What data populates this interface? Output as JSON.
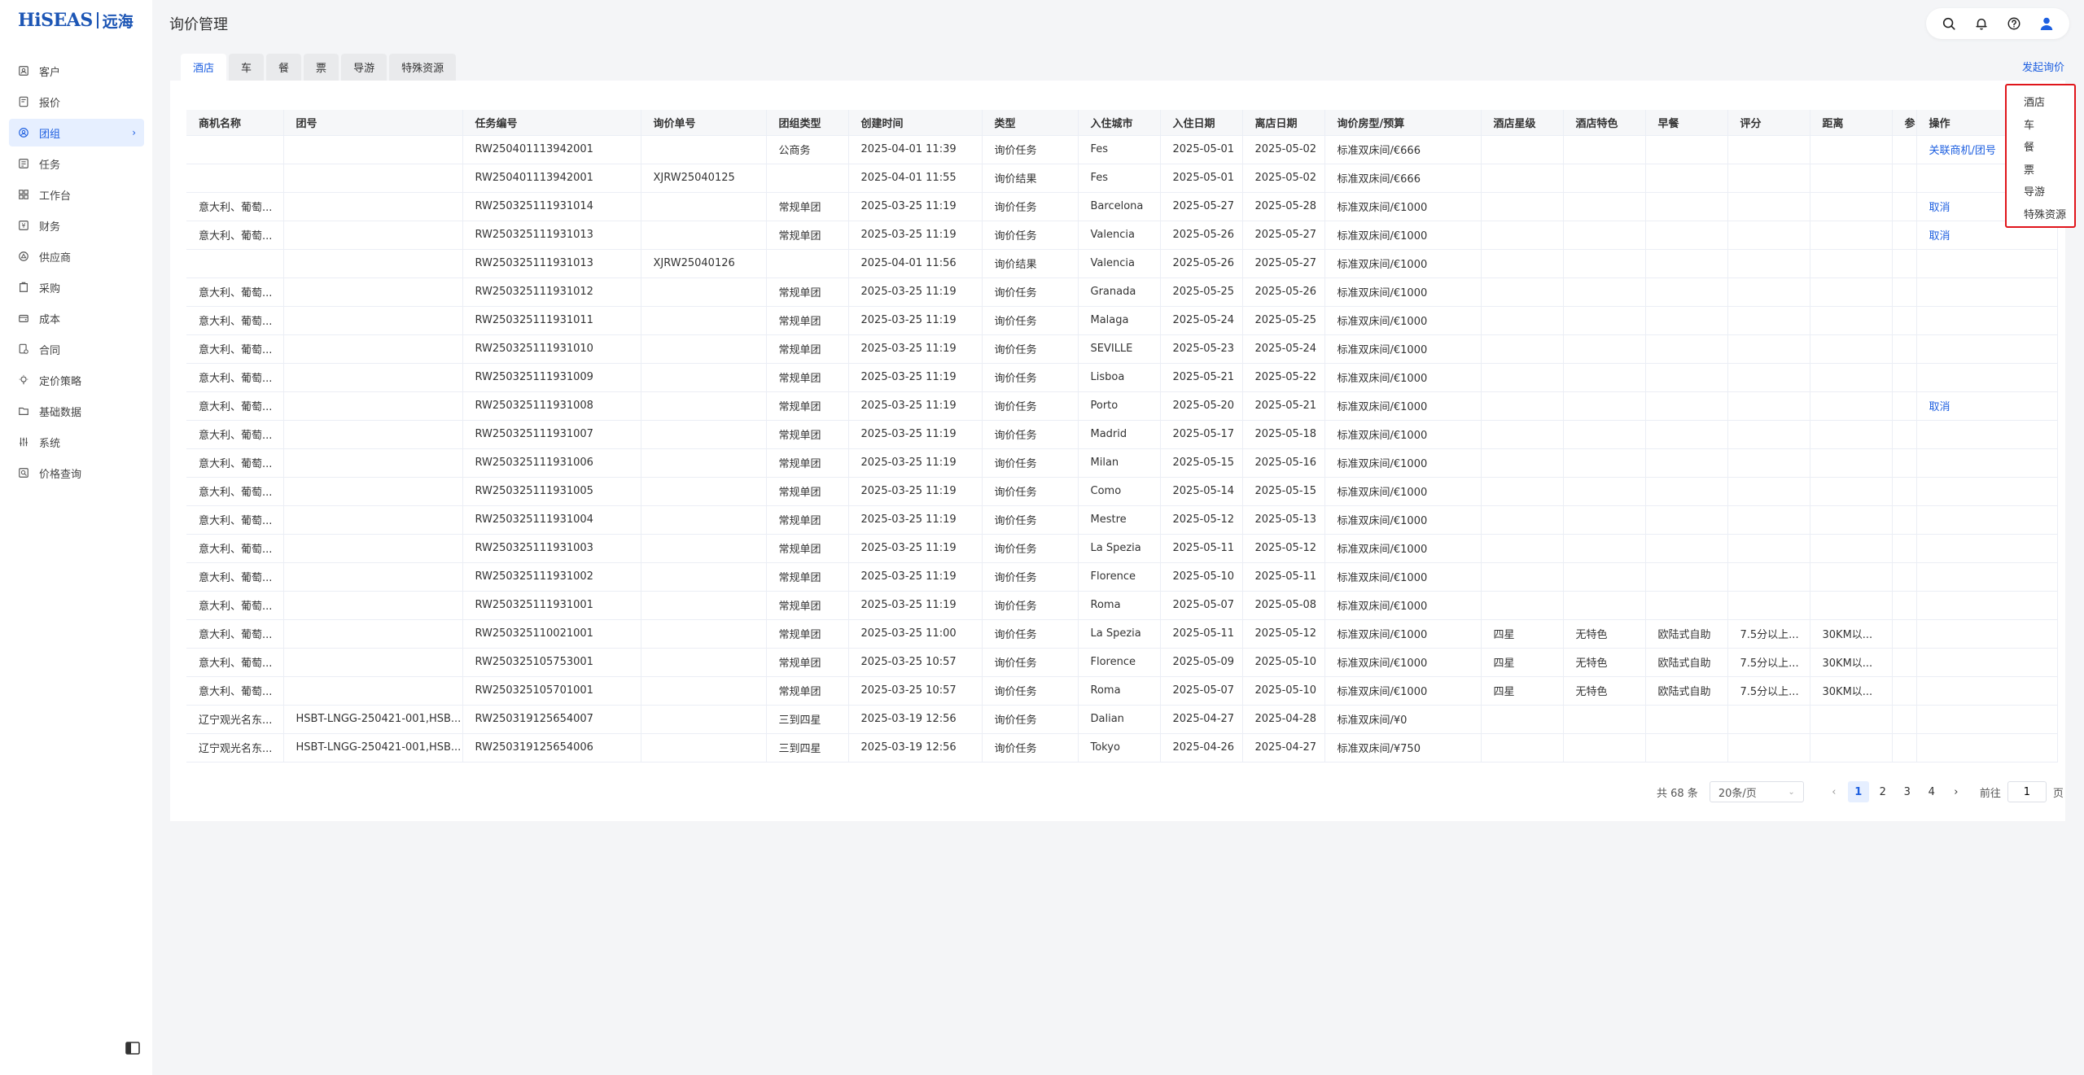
{
  "logo": {
    "main": "HiSEAS",
    "cn": "远海"
  },
  "sidebar": {
    "items": [
      {
        "label": "客户",
        "icon": "customer-icon"
      },
      {
        "label": "报价",
        "icon": "quote-icon"
      },
      {
        "label": "团组",
        "icon": "group-icon",
        "active": true
      },
      {
        "label": "任务",
        "icon": "task-icon"
      },
      {
        "label": "工作台",
        "icon": "workbench-icon"
      },
      {
        "label": "财务",
        "icon": "finance-icon"
      },
      {
        "label": "供应商",
        "icon": "supplier-icon"
      },
      {
        "label": "采购",
        "icon": "purchase-icon"
      },
      {
        "label": "成本",
        "icon": "cost-icon"
      },
      {
        "label": "合同",
        "icon": "contract-icon"
      },
      {
        "label": "定价策略",
        "icon": "pricing-strategy-icon"
      },
      {
        "label": "基础数据",
        "icon": "base-data-icon"
      },
      {
        "label": "系统",
        "icon": "system-icon"
      },
      {
        "label": "价格查询",
        "icon": "price-query-icon"
      }
    ]
  },
  "header": {
    "title": "询价管理"
  },
  "tabs": [
    "酒店",
    "车",
    "餐",
    "票",
    "导游",
    "特殊资源"
  ],
  "launch_label": "发起询价",
  "dropdown": [
    "酒店",
    "车",
    "餐",
    "票",
    "导游",
    "特殊资源"
  ],
  "table": {
    "columns": [
      "商机名称",
      "团号",
      "任务编号",
      "询价单号",
      "团组类型",
      "创建时间",
      "类型",
      "入住城市",
      "入住日期",
      "离店日期",
      "询价房型/预算",
      "酒店星级",
      "酒店特色",
      "早餐",
      "评分",
      "距离",
      "参",
      "操作"
    ],
    "rows": [
      [
        "",
        "",
        "RW250401113942001",
        "",
        "公商务",
        "2025-04-01 11:39",
        "询价任务",
        "Fes",
        "2025-05-01",
        "2025-05-02",
        "标准双床间/€666",
        "",
        "",
        "",
        "",
        "",
        "",
        "关联商机/团号"
      ],
      [
        "",
        "",
        "RW250401113942001",
        "XJRW25040125",
        "",
        "2025-04-01 11:55",
        "询价结果",
        "Fes",
        "2025-05-01",
        "2025-05-02",
        "标准双床间/€666",
        "",
        "",
        "",
        "",
        "",
        "",
        ""
      ],
      [
        "意大利、葡萄...",
        "",
        "RW250325111931014",
        "",
        "常规单团",
        "2025-03-25 11:19",
        "询价任务",
        "Barcelona",
        "2025-05-27",
        "2025-05-28",
        "标准双床间/€1000",
        "",
        "",
        "",
        "",
        "",
        "",
        "取消"
      ],
      [
        "意大利、葡萄...",
        "",
        "RW250325111931013",
        "",
        "常规单团",
        "2025-03-25 11:19",
        "询价任务",
        "Valencia",
        "2025-05-26",
        "2025-05-27",
        "标准双床间/€1000",
        "",
        "",
        "",
        "",
        "",
        "",
        "取消"
      ],
      [
        "",
        "",
        "RW250325111931013",
        "XJRW25040126",
        "",
        "2025-04-01 11:56",
        "询价结果",
        "Valencia",
        "2025-05-26",
        "2025-05-27",
        "标准双床间/€1000",
        "",
        "",
        "",
        "",
        "",
        "",
        ""
      ],
      [
        "意大利、葡萄...",
        "",
        "RW250325111931012",
        "",
        "常规单团",
        "2025-03-25 11:19",
        "询价任务",
        "Granada",
        "2025-05-25",
        "2025-05-26",
        "标准双床间/€1000",
        "",
        "",
        "",
        "",
        "",
        "",
        ""
      ],
      [
        "意大利、葡萄...",
        "",
        "RW250325111931011",
        "",
        "常规单团",
        "2025-03-25 11:19",
        "询价任务",
        "Malaga",
        "2025-05-24",
        "2025-05-25",
        "标准双床间/€1000",
        "",
        "",
        "",
        "",
        "",
        "",
        ""
      ],
      [
        "意大利、葡萄...",
        "",
        "RW250325111931010",
        "",
        "常规单团",
        "2025-03-25 11:19",
        "询价任务",
        "SEVILLE",
        "2025-05-23",
        "2025-05-24",
        "标准双床间/€1000",
        "",
        "",
        "",
        "",
        "",
        "",
        ""
      ],
      [
        "意大利、葡萄...",
        "",
        "RW250325111931009",
        "",
        "常规单团",
        "2025-03-25 11:19",
        "询价任务",
        "Lisboa",
        "2025-05-21",
        "2025-05-22",
        "标准双床间/€1000",
        "",
        "",
        "",
        "",
        "",
        "",
        ""
      ],
      [
        "意大利、葡萄...",
        "",
        "RW250325111931008",
        "",
        "常规单团",
        "2025-03-25 11:19",
        "询价任务",
        "Porto",
        "2025-05-20",
        "2025-05-21",
        "标准双床间/€1000",
        "",
        "",
        "",
        "",
        "",
        "",
        "取消"
      ],
      [
        "意大利、葡萄...",
        "",
        "RW250325111931007",
        "",
        "常规单团",
        "2025-03-25 11:19",
        "询价任务",
        "Madrid",
        "2025-05-17",
        "2025-05-18",
        "标准双床间/€1000",
        "",
        "",
        "",
        "",
        "",
        "",
        ""
      ],
      [
        "意大利、葡萄...",
        "",
        "RW250325111931006",
        "",
        "常规单团",
        "2025-03-25 11:19",
        "询价任务",
        "Milan",
        "2025-05-15",
        "2025-05-16",
        "标准双床间/€1000",
        "",
        "",
        "",
        "",
        "",
        "",
        ""
      ],
      [
        "意大利、葡萄...",
        "",
        "RW250325111931005",
        "",
        "常规单团",
        "2025-03-25 11:19",
        "询价任务",
        "Como",
        "2025-05-14",
        "2025-05-15",
        "标准双床间/€1000",
        "",
        "",
        "",
        "",
        "",
        "",
        ""
      ],
      [
        "意大利、葡萄...",
        "",
        "RW250325111931004",
        "",
        "常规单团",
        "2025-03-25 11:19",
        "询价任务",
        "Mestre",
        "2025-05-12",
        "2025-05-13",
        "标准双床间/€1000",
        "",
        "",
        "",
        "",
        "",
        "",
        ""
      ],
      [
        "意大利、葡萄...",
        "",
        "RW250325111931003",
        "",
        "常规单团",
        "2025-03-25 11:19",
        "询价任务",
        "La Spezia",
        "2025-05-11",
        "2025-05-12",
        "标准双床间/€1000",
        "",
        "",
        "",
        "",
        "",
        "",
        ""
      ],
      [
        "意大利、葡萄...",
        "",
        "RW250325111931002",
        "",
        "常规单团",
        "2025-03-25 11:19",
        "询价任务",
        "Florence",
        "2025-05-10",
        "2025-05-11",
        "标准双床间/€1000",
        "",
        "",
        "",
        "",
        "",
        "",
        ""
      ],
      [
        "意大利、葡萄...",
        "",
        "RW250325111931001",
        "",
        "常规单团",
        "2025-03-25 11:19",
        "询价任务",
        "Roma",
        "2025-05-07",
        "2025-05-08",
        "标准双床间/€1000",
        "",
        "",
        "",
        "",
        "",
        "",
        ""
      ],
      [
        "意大利、葡萄...",
        "",
        "RW250325110021001",
        "",
        "常规单团",
        "2025-03-25 11:00",
        "询价任务",
        "La Spezia",
        "2025-05-11",
        "2025-05-12",
        "标准双床间/€1000",
        "四星",
        "无特色",
        "欧陆式自助",
        "7.5分以上...",
        "30KM以...",
        "",
        ""
      ],
      [
        "意大利、葡萄...",
        "",
        "RW250325105753001",
        "",
        "常规单团",
        "2025-03-25 10:57",
        "询价任务",
        "Florence",
        "2025-05-09",
        "2025-05-10",
        "标准双床间/€1000",
        "四星",
        "无特色",
        "欧陆式自助",
        "7.5分以上...",
        "30KM以...",
        "",
        ""
      ],
      [
        "意大利、葡萄...",
        "",
        "RW250325105701001",
        "",
        "常规单团",
        "2025-03-25 10:57",
        "询价任务",
        "Roma",
        "2025-05-07",
        "2025-05-10",
        "标准双床间/€1000",
        "四星",
        "无特色",
        "欧陆式自助",
        "7.5分以上...",
        "30KM以...",
        "",
        ""
      ],
      [
        "辽宁观光名东...",
        "HSBT-LNGG-250421-001,HSB...",
        "RW250319125654007",
        "",
        "三到四星",
        "2025-03-19 12:56",
        "询价任务",
        "Dalian",
        "2025-04-27",
        "2025-04-28",
        "标准双床间/¥0",
        "",
        "",
        "",
        "",
        "",
        "",
        ""
      ],
      [
        "辽宁观光名东...",
        "HSBT-LNGG-250421-001,HSB...",
        "RW250319125654006",
        "",
        "三到四星",
        "2025-03-19 12:56",
        "询价任务",
        "Tokyo",
        "2025-04-26",
        "2025-04-27",
        "标准双床间/¥750",
        "",
        "",
        "",
        "",
        "",
        "",
        ""
      ]
    ]
  },
  "pagination": {
    "total": "共 68 条",
    "page_size": "20条/页",
    "pages": [
      "1",
      "2",
      "3",
      "4"
    ],
    "current": "1",
    "goto_label": "前往",
    "goto_value": "1",
    "page_unit": "页"
  }
}
